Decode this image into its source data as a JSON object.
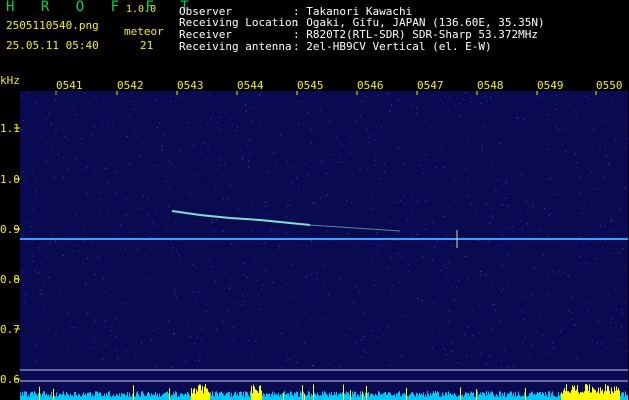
{
  "header": {
    "app_title": "H R O F F T",
    "version": "1.0.0",
    "filename": "2505110540.png",
    "meteor_label": "meteor",
    "timestamp": "25.05.11 05:40",
    "meteor_count": "21",
    "fields": [
      {
        "label": "Observer",
        "value": ": Takanori Kawachi"
      },
      {
        "label": "Receiving Location",
        "value": ": Ogaki, Gifu, JAPAN (136.60E, 35.35N)"
      },
      {
        "label": "Receiver",
        "value": ": R820T2(RTL-SDR) SDR-Sharp 53.372MHz"
      },
      {
        "label": "Receiving antenna",
        "value": ": 2el-HB9CV Vertical (el. E-W)"
      }
    ]
  },
  "x_axis": {
    "ticks": [
      "0541",
      "0542",
      "0543",
      "0544",
      "0545",
      "0546",
      "0547",
      "0548",
      "0549",
      "0550"
    ]
  },
  "y_axis": {
    "unit": "kHz",
    "ticks": [
      "1.1",
      "1.0",
      "0.9",
      "0.8",
      "0.7",
      "0.6"
    ]
  },
  "colors": {
    "background": "#0a0a52",
    "carrier": "#3aa0ff",
    "meteor_trail": "#7fe0d0",
    "power_bars": "#00c8ff",
    "power_peaks": "#ffff00",
    "header_green": "#00d25a",
    "header_yellow": "#f2f200"
  }
}
